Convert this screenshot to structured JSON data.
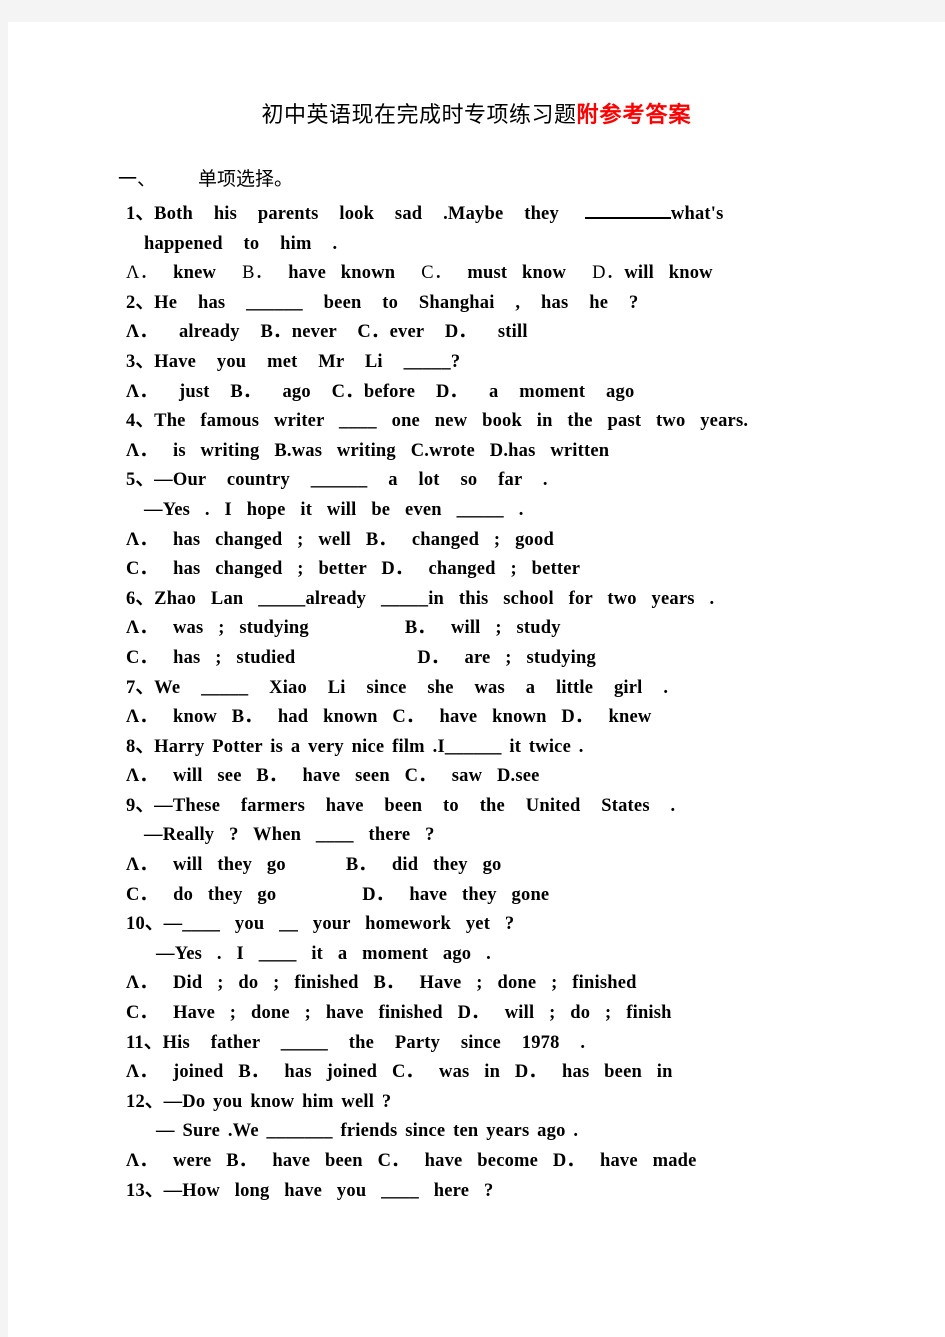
{
  "document": {
    "title_black": "初中英语现在完成时专项练习题",
    "title_red": "附参考答案",
    "title_red_color": "#ff0000",
    "page_background": "#ffffff",
    "canvas_background": "#f4f4f4"
  },
  "section": {
    "number": "一、",
    "label": "单项选择。"
  },
  "questions": [
    {
      "num": "1、",
      "stem_lines": [
        "Both    his    parents    look    sad .Maybe  they",
        "happened    to    him ."
      ],
      "stem_tail": "what's",
      "options_lines": [
        {
          "a_letter": "Λ．",
          "a_text": "knew",
          "b_letter": "B．",
          "b_text": "have known",
          "c_letter": "C．",
          "c_text": "must know",
          "d_letter": "D．",
          "d_text": "will know"
        }
      ]
    },
    {
      "num": "2、",
      "stem": "He  has ______ been   to   Shanghai , has   he ?",
      "opts": "Λ． already     B．never     C．ever     D． still"
    },
    {
      "num": "3、",
      "stem": "Have  you   met  Mr  Li _____?",
      "opts": "Λ． just    B． ago       C．before    D． a moment ago"
    },
    {
      "num": "4、",
      "stem": "The famous  writer ____ one new book in the past two years.",
      "opts": "Λ． is  writing    B.was  writing   C.wrote  D.has  written"
    },
    {
      "num": "5、",
      "stem_a": "—Our  country ______ a lot so far .",
      "stem_b": "—Yes . I hope it will be even _____ .",
      "opts_a": "Λ． has  changed ; well    B． changed ; good",
      "opts_b": "C． has  changed ; better  D． changed ; better"
    },
    {
      "num": "6、",
      "stem": "Zhao Lan _____already  _____in this school for two years .",
      "opts_a_left": "Λ． was ; studying",
      "opts_a_right": "B． will ; study",
      "opts_b_left": "C． has ; studied",
      "opts_b_right": "D． are ; studying"
    },
    {
      "num": "7、",
      "stem": "We _____ Xiao  Li  since  she  was  a  little  girl .",
      "opts": "Λ． know   B． had  known   C． have  known   D． knew"
    },
    {
      "num": "8、",
      "stem": "Harry  Potter  is a very nice film .I______ it twice .",
      "opts": "Λ． will  see     B． have  seen    C． saw   D.see"
    },
    {
      "num": "9、",
      "stem_a": "—These  farmers  have  been  to  the  United  States .",
      "stem_b": "—Really ? When ____  there ?",
      "opts_a_left": "Λ． will  they  go",
      "opts_a_right": "B． did  they  go",
      "opts_b_left": "C． do  they  go",
      "opts_b_right": "D． have  they  gone"
    },
    {
      "num": "10、",
      "stem_a": "—____ you __ your  homework  yet ?",
      "stem_b": "—Yes . I ____ it a  moment  ago .",
      "opts_a": "Λ． Did ; do ; finished     B． Have ; done ; finished",
      "opts_b": "C． Have ; done ; have  finished    D． will ; do ; finish"
    },
    {
      "num": "11、",
      "stem": "His  father _____ the  Party  since  1978 .",
      "opts": "Λ． joined    B． has joined  C． was in  D． has  been  in"
    },
    {
      "num": "12、",
      "stem_a": "—Do you know him well ?",
      "stem_b": "—  Sure .We _______ friends since ten years ago .",
      "opts": "Λ． were    B． have been  C． have become    D． have made"
    },
    {
      "num": "13、",
      "stem": "—How  long  have  you ____ here ?"
    }
  ]
}
